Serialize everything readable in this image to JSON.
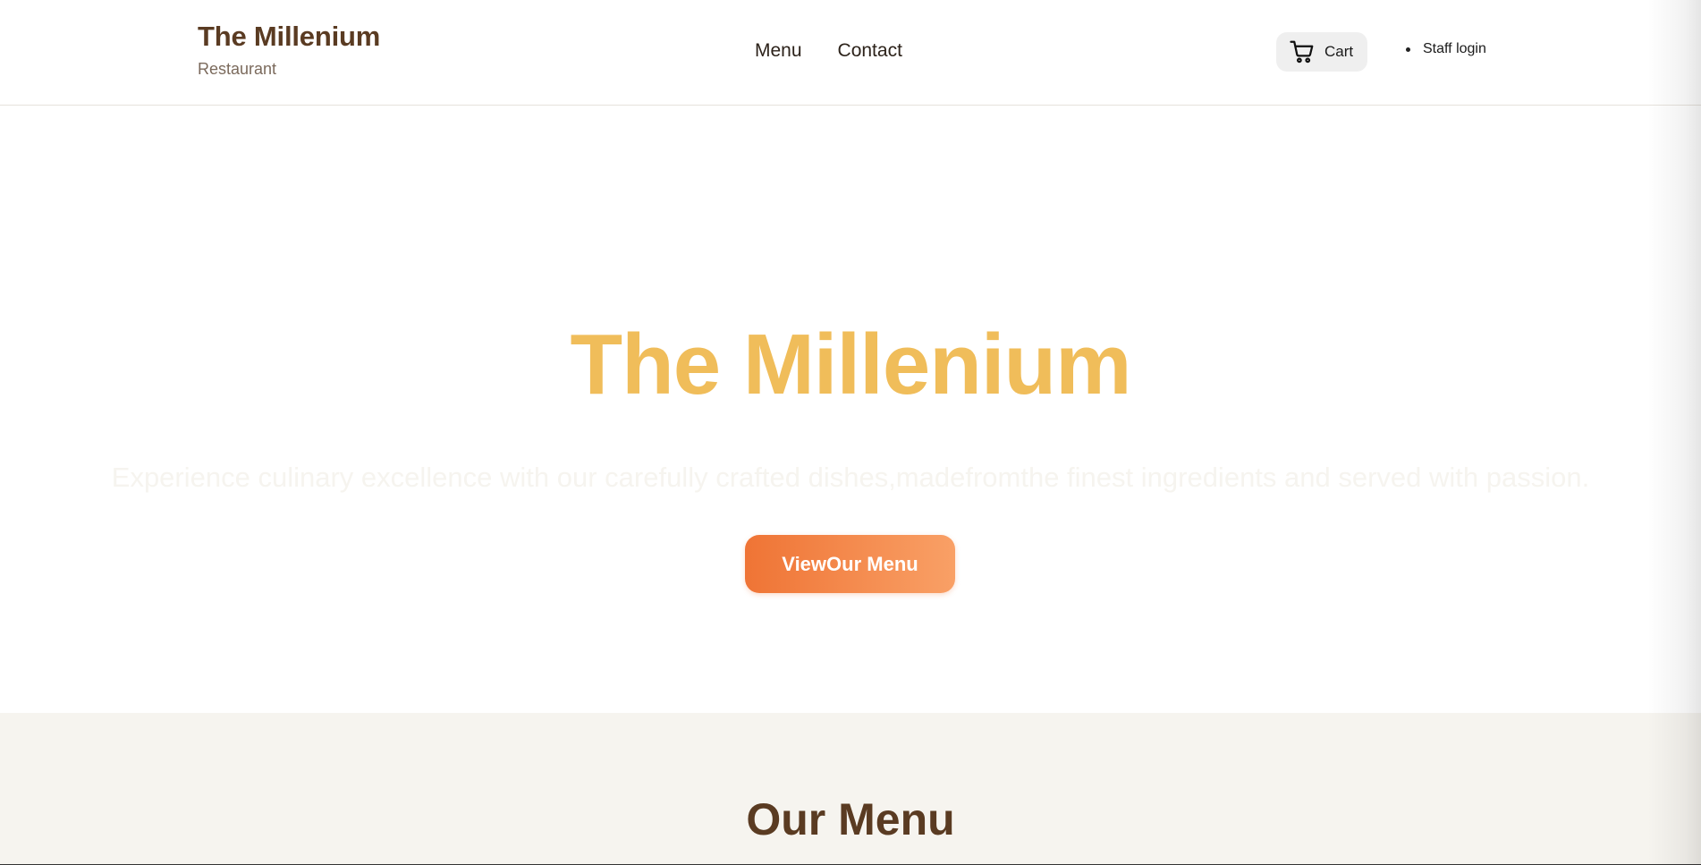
{
  "header": {
    "brand_title": "The Millenium",
    "brand_subtitle": "Restaurant",
    "nav": [
      {
        "label": "Menu"
      },
      {
        "label": "Contact"
      }
    ],
    "cart_label": "Cart",
    "staff_login_label": "Staff login"
  },
  "hero": {
    "title": "The Millenium",
    "tagline": "Experience culinary excellence with our carefully crafted dishes,madefromthe finest ingredients and served with passion.",
    "cta_label": "ViewOur Menu"
  },
  "menu_section": {
    "heading": "Our Menu"
  },
  "colors": {
    "brand_brown": "#5a3b22",
    "hero_title_gold": "#f0bd5a",
    "cta_gradient_start": "#ef7435",
    "cta_gradient_end": "#f9a066",
    "section_bg": "#f6f4ef"
  },
  "icons": {
    "cart": "shopping-cart-icon"
  }
}
